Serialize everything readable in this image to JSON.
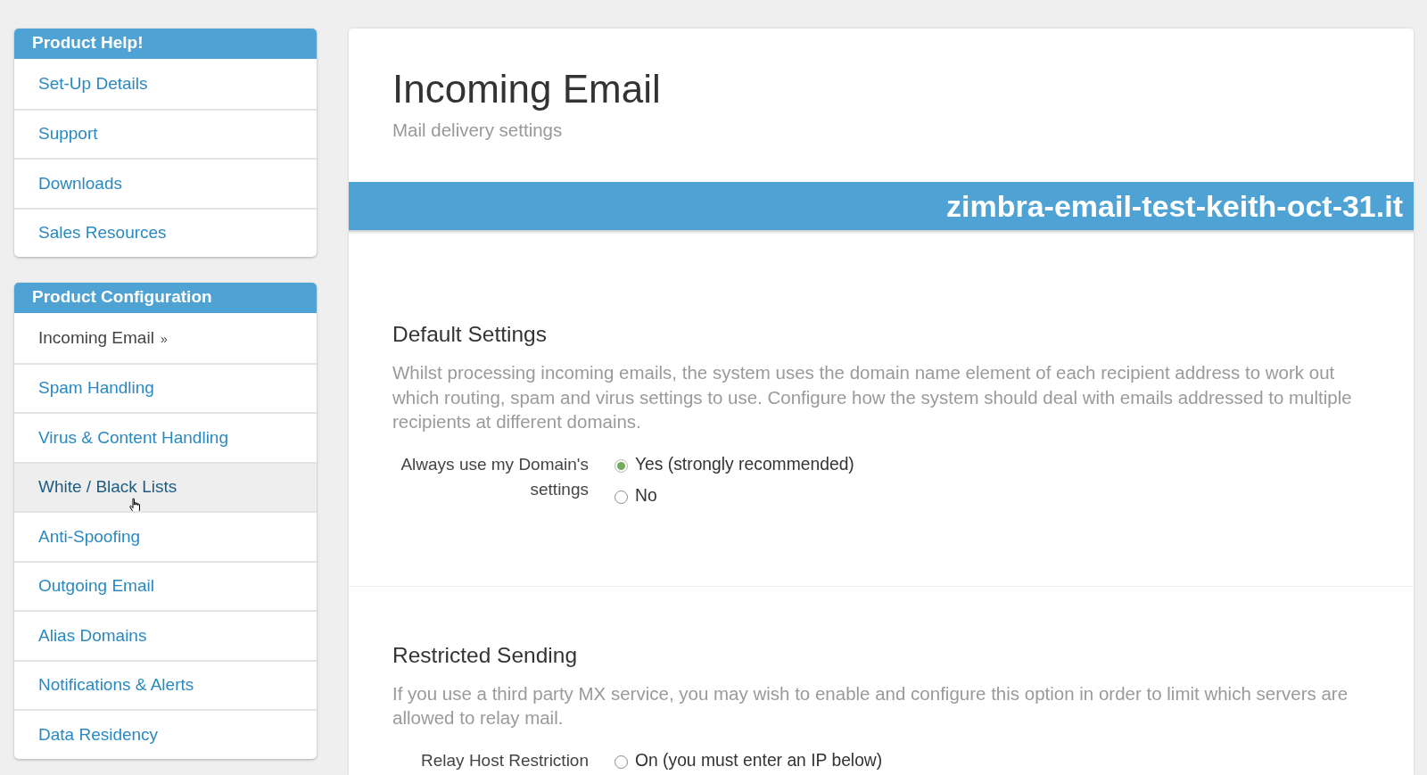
{
  "sidebar": {
    "panels": [
      {
        "title": "Product Help!",
        "items": [
          {
            "label": "Set-Up Details",
            "selected": false,
            "hovered": false
          },
          {
            "label": "Support",
            "selected": false,
            "hovered": false
          },
          {
            "label": "Downloads",
            "selected": false,
            "hovered": false
          },
          {
            "label": "Sales Resources",
            "selected": false,
            "hovered": false
          }
        ]
      },
      {
        "title": "Product Configuration",
        "items": [
          {
            "label": "Incoming Email",
            "suffix": "»",
            "selected": true,
            "hovered": false
          },
          {
            "label": "Spam Handling",
            "selected": false,
            "hovered": false
          },
          {
            "label": "Virus & Content Handling",
            "selected": false,
            "hovered": false
          },
          {
            "label": "White / Black Lists",
            "selected": false,
            "hovered": true
          },
          {
            "label": "Anti-Spoofing",
            "selected": false,
            "hovered": false
          },
          {
            "label": "Outgoing Email",
            "selected": false,
            "hovered": false
          },
          {
            "label": "Alias Domains",
            "selected": false,
            "hovered": false
          },
          {
            "label": "Notifications & Alerts",
            "selected": false,
            "hovered": false
          },
          {
            "label": "Data Residency",
            "selected": false,
            "hovered": false
          }
        ]
      }
    ]
  },
  "page": {
    "title": "Incoming Email",
    "subtitle": "Mail delivery settings",
    "domain_banner": "zimbra-email-test-keith-oct-31.it"
  },
  "sections": [
    {
      "heading": "Default Settings",
      "description": "Whilst processing incoming emails, the system uses the domain name element of each recipient address to work out which routing, spam and virus settings to use. Configure how the system should deal with emails addressed to multiple recipients at different domains.",
      "fields": [
        {
          "label": "Always use my Domain's settings",
          "options": [
            {
              "label": "Yes (strongly recommended)",
              "selected": true
            },
            {
              "label": "No",
              "selected": false
            }
          ]
        }
      ]
    },
    {
      "heading": "Restricted Sending",
      "description": "If you use a third party MX service, you may wish to enable and configure this option in order to limit which servers are allowed to relay mail.",
      "fields": [
        {
          "label": "Relay Host Restriction",
          "options": [
            {
              "label": "On (you must enter an IP below)",
              "selected": false
            }
          ]
        }
      ]
    }
  ]
}
